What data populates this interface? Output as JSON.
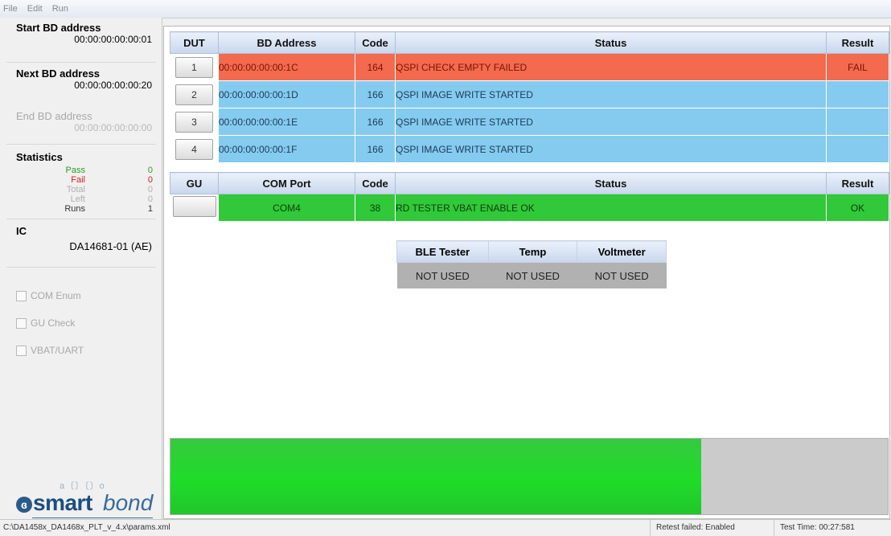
{
  "menu": [
    "File",
    "Edit",
    "Run"
  ],
  "left": {
    "start_label": "Start BD address",
    "start_value": "00:00:00:00:00:01",
    "next_label": "Next BD address",
    "next_value": "00:00:00:00:00:20",
    "end_label": "End BD address",
    "end_value": "00:00:00:00:00:00",
    "stats_label": "Statistics",
    "stats": [
      {
        "label": "Pass",
        "value": "0",
        "color": "#2c9a2c"
      },
      {
        "label": "Fail",
        "value": "0",
        "color": "#d02020"
      },
      {
        "label": "Total",
        "value": "0",
        "color": "#b0b0b0"
      },
      {
        "label": "Left",
        "value": "0",
        "color": "#b0b0b0"
      },
      {
        "label": "Runs",
        "value": "1",
        "color": "#333333"
      }
    ],
    "ic_label": "IC",
    "ic_value": "DA14681-01 (AE)",
    "checks": [
      "COM Enum",
      "GU Check",
      "VBAT/UART"
    ]
  },
  "logo": {
    "glyph": "a〔〕〔〕o",
    "smart": "smart",
    "bond": "bond"
  },
  "dut_table": {
    "headers": [
      "DUT",
      "BD Address",
      "Code",
      "Status",
      "Result"
    ],
    "rows": [
      {
        "btn": "1",
        "addr": "00:00:00:00:00:1C",
        "code": "164",
        "status": "QSPI CHECK EMPTY FAILED",
        "result": "FAIL",
        "color": "#f36a4f"
      },
      {
        "btn": "2",
        "addr": "00:00:00:00:00:1D",
        "code": "166",
        "status": "QSPI IMAGE WRITE STARTED",
        "result": "",
        "color": "#85cbf0"
      },
      {
        "btn": "3",
        "addr": "00:00:00:00:00:1E",
        "code": "166",
        "status": "QSPI IMAGE WRITE STARTED",
        "result": "",
        "color": "#85cbf0"
      },
      {
        "btn": "4",
        "addr": "00:00:00:00:00:1F",
        "code": "166",
        "status": "QSPI IMAGE WRITE STARTED",
        "result": "",
        "color": "#85cbf0"
      }
    ]
  },
  "gu_table": {
    "headers": [
      "GU",
      "COM Port",
      "Code",
      "Status",
      "Result"
    ],
    "row": {
      "btn": "",
      "port": "COM4",
      "code": "38",
      "status": "RD TESTER VBAT ENABLE OK",
      "result": "OK",
      "color": "#31c83a"
    }
  },
  "instruments": {
    "headers": [
      "BLE Tester",
      "Temp",
      "Voltmeter"
    ],
    "values": [
      "NOT USED",
      "NOT USED",
      "NOT USED"
    ]
  },
  "progress": {
    "fraction": 0.74
  },
  "statusbar": {
    "path": "C:\\DA1458x_DA1468x_PLT_v_4.x\\params.xml",
    "retest": "Retest failed: Enabled",
    "test_time": "Test Time: 00:27:581"
  }
}
